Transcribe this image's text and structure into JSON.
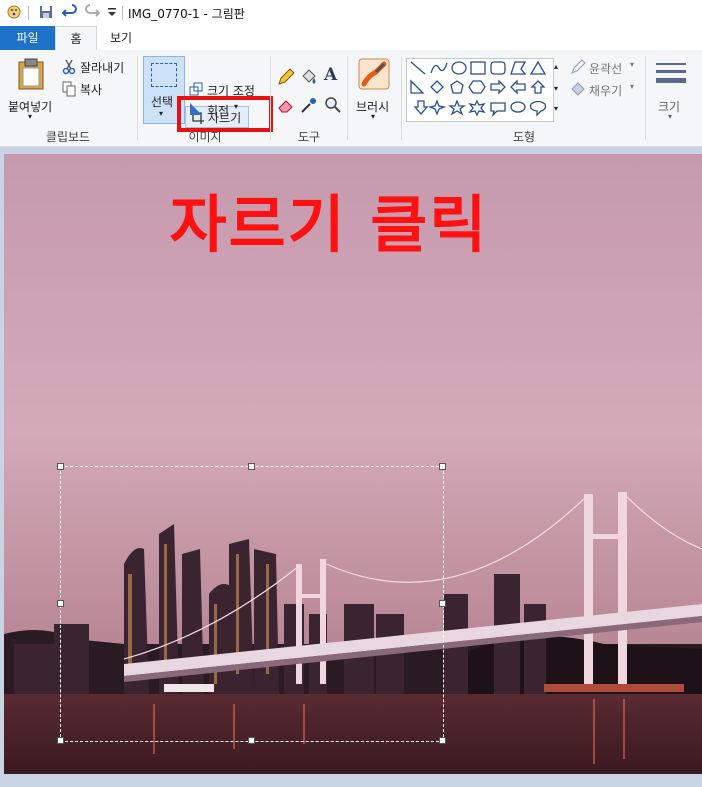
{
  "window": {
    "title": "IMG_0770-1 - 그림판"
  },
  "tabs": [
    {
      "label": "파일"
    },
    {
      "label": "홈"
    },
    {
      "label": "보기"
    }
  ],
  "clipboard": {
    "paste_label": "붙여넣기",
    "cut_label": "잘라내기",
    "copy_label": "복사",
    "group_label": "클립보드"
  },
  "image": {
    "select_label": "선택",
    "crop_label": "자르기",
    "resize_label": "크기 조정",
    "rotate_label": "회전",
    "group_label": "이미지"
  },
  "tools": {
    "group_label": "도구"
  },
  "brushes": {
    "label": "브러시"
  },
  "shapes": {
    "outline_label": "윤곽선",
    "fill_label": "채우기",
    "group_label": "도형"
  },
  "size": {
    "label": "크기"
  },
  "annotation": {
    "text": "자르기 클릭"
  },
  "colors": {
    "accent": "#1e73c8",
    "highlight": "#e81010",
    "annotation": "#ff1111"
  }
}
